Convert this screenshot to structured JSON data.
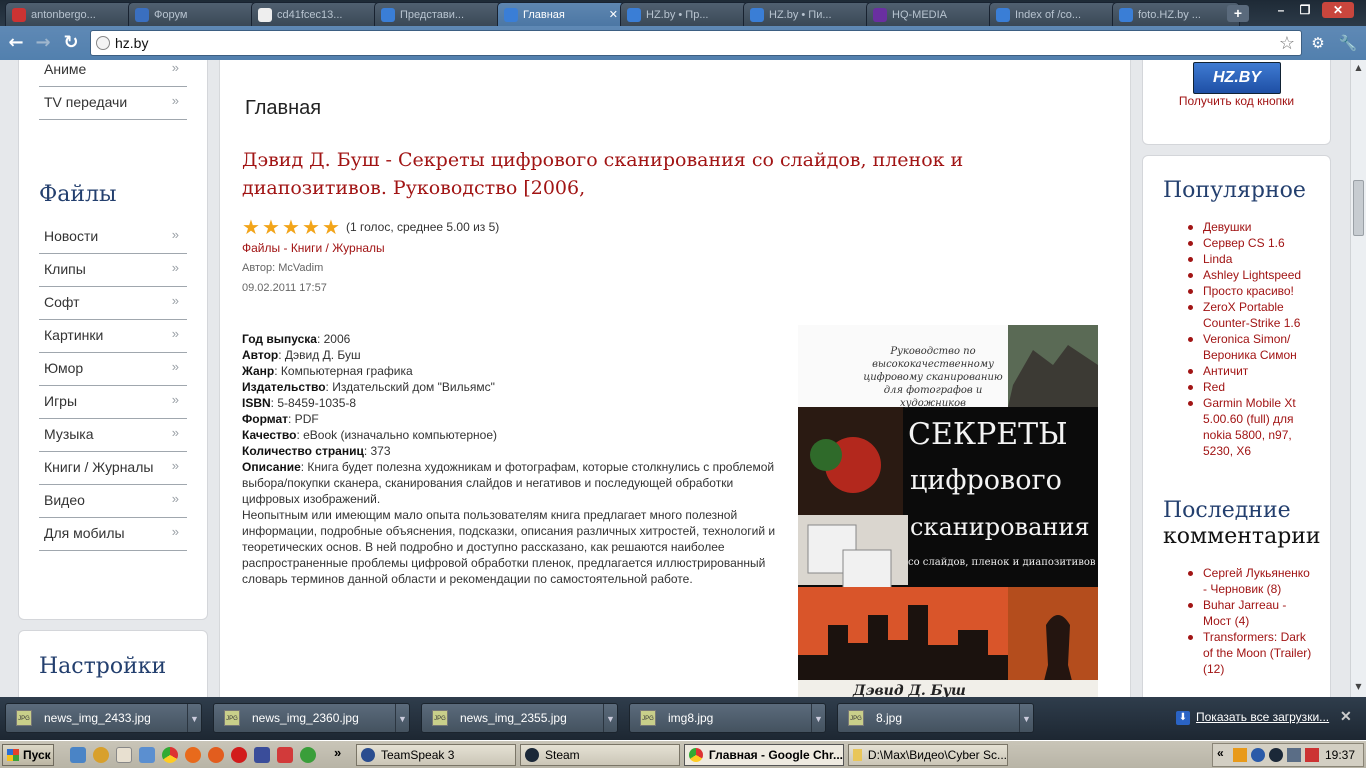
{
  "browser": {
    "tabs": [
      {
        "label": "antonbergo...",
        "icon": "v-icon"
      },
      {
        "label": "Форум",
        "icon": "forum-icon"
      },
      {
        "label": "cd41fcec13...",
        "icon": "page-icon"
      },
      {
        "label": "Представи...",
        "icon": "hz-icon"
      },
      {
        "label": "Главная",
        "icon": "hz-icon"
      },
      {
        "label": "HZ.by • Пр...",
        "icon": "hz-icon"
      },
      {
        "label": "HZ.by • Пи...",
        "icon": "hz-icon"
      },
      {
        "label": "HQ-MEDIA",
        "icon": "hq-icon"
      },
      {
        "label": "Index of /co...",
        "icon": "hz-icon"
      },
      {
        "label": "foto.HZ.by ...",
        "icon": "hz-icon"
      }
    ],
    "active_tab_index": 4,
    "url": "hz.by"
  },
  "left_sidebar": {
    "top_items": [
      {
        "label": "Аниме"
      },
      {
        "label": "TV передачи"
      }
    ],
    "files_title": "Файлы",
    "files_items": [
      {
        "label": "Новости"
      },
      {
        "label": "Клипы"
      },
      {
        "label": "Софт"
      },
      {
        "label": "Картинки"
      },
      {
        "label": "Юмор"
      },
      {
        "label": "Игры"
      },
      {
        "label": "Музыка"
      },
      {
        "label": "Книги / Журналы"
      },
      {
        "label": "Видео"
      },
      {
        "label": "Для мобилы"
      }
    ],
    "settings_title": "Настройки",
    "arrow": "»"
  },
  "main": {
    "page_title": "Главная",
    "article_title": "Дэвид Д. Буш - Секреты цифрового сканирования со слайдов, пленок и диапозитивов. Руководство [2006,",
    "rating": {
      "stars": 5,
      "text": "(1 голос, среднее 5.00 из 5)"
    },
    "category_1": "Файлы",
    "category_sep": " - ",
    "category_2": "Книги / Журналы",
    "author_line": "Автор: McVadim",
    "date": "09.02.2011 17:57",
    "props": [
      {
        "k": "Год выпуска",
        "v": ": 2006"
      },
      {
        "k": "Автор",
        "v": ": Дэвид Д. Буш"
      },
      {
        "k": "Жанр",
        "v": ": Компьютерная графика"
      },
      {
        "k": "Издательство",
        "v": ": Издательский дом \"Вильямс\""
      },
      {
        "k": "ISBN",
        "v": ": 5-8459-1035-8"
      },
      {
        "k": "Формат",
        "v": ": PDF"
      },
      {
        "k": "Качество",
        "v": ": eBook (изначально компьютерное)"
      },
      {
        "k": "Количество страниц",
        "v": ": 373"
      },
      {
        "k": "Описание",
        "v": ": Книга будет полезна художникам и фотографам, которые столкнулись с проблемой выбора/покупки сканера, сканирования слайдов и негативов и последующей обработки цифровых изображений."
      }
    ],
    "description_2": "Неопытным или имеющим мало опыта пользователям книга предлагает много полезной информации, подробные объяснения, подсказки, описания различных хитростей, технологий и теоретических основ. В ней подробно и доступно рассказано, как решаются наиболее распространенные проблемы цифровой обработки пленок, предлагается иллюстрированный словарь терминов данной области и рекомендации по самостоятельной работе.",
    "cover": {
      "subtitle": "Руководство по высококачественному цифровому сканированию для фотографов и художников",
      "title_1": "СЕКРЕТЫ",
      "title_2": "цифрового",
      "title_3": "сканирования",
      "tagline": "со слайдов, пленок и диапозитивов",
      "author": "Дэвид Д. Буш"
    }
  },
  "right_sidebar": {
    "logo_text": "HZ.BY",
    "get_code": "Получить код кнопки",
    "popular_title": "Популярное",
    "popular": [
      "Девушки",
      "Сервер CS 1.6",
      "Linda",
      "Ashley Lightspeed",
      "Просто красиво!",
      "ZeroX Portable Counter-Strike 1.6",
      "Veronica Simon/ Вероника Симон",
      "Античит",
      "Red",
      "Garmin Mobile Xt 5.00.60 (full) для nokia 5800, n97, 5230, X6"
    ],
    "comments_title_1": "Последние",
    "comments_title_2": "комментарии",
    "comments": [
      "Сергей Лукьяненко - Черновик (8)",
      "Buhar Jarreau - Мост (4)",
      "Transformers: Dark of the Moon (Trailer) (12)"
    ]
  },
  "downloads": {
    "items": [
      "news_img_2433.jpg",
      "news_img_2360.jpg",
      "news_img_2355.jpg",
      "img8.jpg",
      "8.jpg"
    ],
    "file_badge": "JPG",
    "show_all": "Показать все загрузки..."
  },
  "taskbar": {
    "start": "Пуск",
    "buttons": [
      "TeamSpeak 3",
      "Steam",
      "Главная - Google Chr...",
      "D:\\Max\\Видео\\Cyber Sc..."
    ],
    "clock": "19:37",
    "chevron_left": "«",
    "chevron_right": "»"
  }
}
